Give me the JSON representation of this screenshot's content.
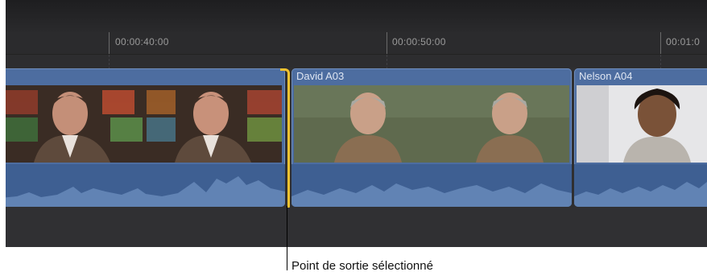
{
  "ruler": {
    "ticks": [
      "00:00:40:00",
      "00:00:50:00",
      "00:01:0"
    ]
  },
  "clips": [
    {
      "name": "",
      "kind": "man-stripe-shirt"
    },
    {
      "name": "David A03",
      "kind": "man-gray-hair"
    },
    {
      "name": "Nelson A04",
      "kind": "man-curly-hair"
    }
  ],
  "callout": {
    "label": "Point de sortie sélectionné"
  },
  "colors": {
    "selection": "#f2c230",
    "clip": "#4d6da0",
    "audio": "#3e5f92",
    "background": "#2f2f31"
  }
}
